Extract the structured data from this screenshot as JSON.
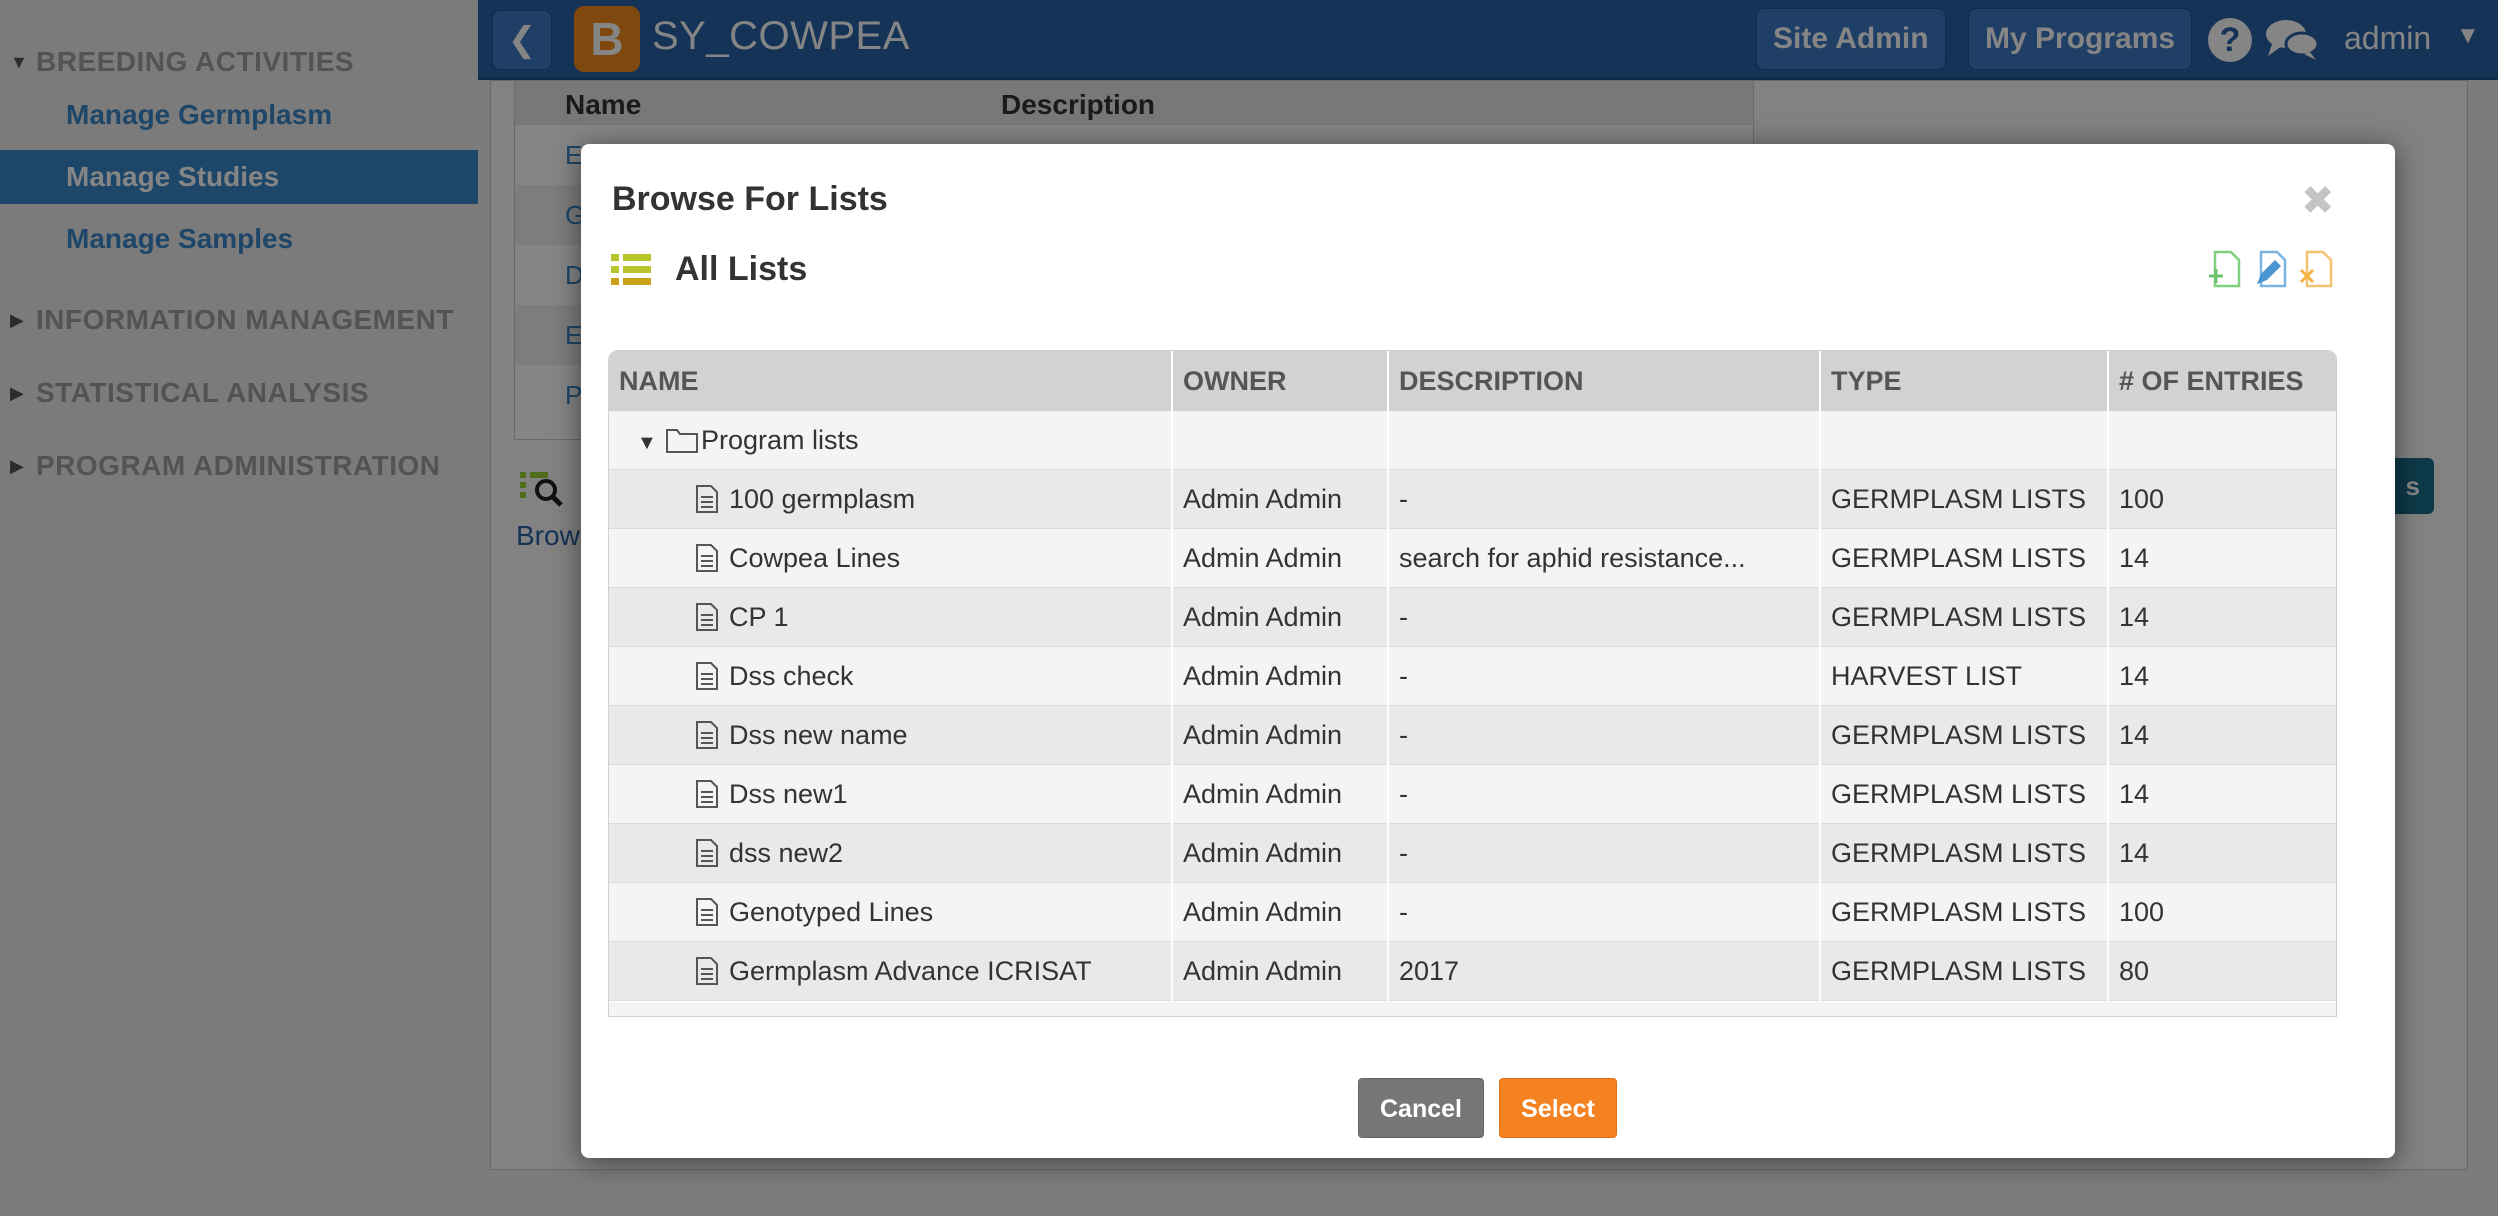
{
  "sidebar": {
    "sections": [
      {
        "label": "BREEDING ACTIVITIES",
        "expanded": true
      },
      {
        "label": "INFORMATION MANAGEMENT",
        "expanded": false
      },
      {
        "label": "STATISTICAL ANALYSIS",
        "expanded": false
      },
      {
        "label": "PROGRAM ADMINISTRATION",
        "expanded": false
      }
    ],
    "items": [
      {
        "label": "Manage Germplasm",
        "active": false
      },
      {
        "label": "Manage Studies",
        "active": true
      },
      {
        "label": "Manage Samples",
        "active": false
      }
    ]
  },
  "topbar": {
    "logo_letter": "B",
    "title": "SY_COWPEA",
    "site_admin": "Site Admin",
    "my_programs": "My Programs",
    "help": "?",
    "user": "admin"
  },
  "background": {
    "table_headers": [
      "Name",
      "Description"
    ],
    "rows": [
      "E",
      "G",
      "D",
      "E",
      "P"
    ],
    "browse_label": "Brow",
    "teal_button": "s"
  },
  "modal": {
    "title": "Browse For Lists",
    "subtitle": "All Lists",
    "columns": [
      "NAME",
      "OWNER",
      "DESCRIPTION",
      "TYPE",
      "# OF ENTRIES"
    ],
    "folder": {
      "name": "Program lists",
      "expanded": true
    },
    "rows": [
      {
        "name": "100 germplasm",
        "owner": "Admin Admin",
        "description": "-",
        "type": "GERMPLASM LISTS",
        "entries": "100"
      },
      {
        "name": "Cowpea Lines",
        "owner": "Admin Admin",
        "description": "search for aphid resistance...",
        "type": "GERMPLASM LISTS",
        "entries": "14"
      },
      {
        "name": "CP 1",
        "owner": "Admin Admin",
        "description": "-",
        "type": "GERMPLASM LISTS",
        "entries": "14"
      },
      {
        "name": "Dss check",
        "owner": "Admin Admin",
        "description": "-",
        "type": "HARVEST LIST",
        "entries": "14"
      },
      {
        "name": "Dss new name",
        "owner": "Admin Admin",
        "description": "-",
        "type": "GERMPLASM LISTS",
        "entries": "14"
      },
      {
        "name": "Dss new1",
        "owner": "Admin Admin",
        "description": "-",
        "type": "GERMPLASM LISTS",
        "entries": "14"
      },
      {
        "name": "dss new2",
        "owner": "Admin Admin",
        "description": "-",
        "type": "GERMPLASM LISTS",
        "entries": "14"
      },
      {
        "name": "Genotyped Lines",
        "owner": "Admin Admin",
        "description": "-",
        "type": "GERMPLASM LISTS",
        "entries": "100"
      },
      {
        "name": "Germplasm Advance ICRISAT",
        "owner": "Admin Admin",
        "description": "2017",
        "type": "GERMPLASM LISTS",
        "entries": "80"
      }
    ],
    "cancel_label": "Cancel",
    "select_label": "Select"
  },
  "colors": {
    "topbar": "#2a62a8",
    "accent_blue": "#3a87c8",
    "select_orange": "#f58220",
    "cancel_gray": "#777777"
  }
}
